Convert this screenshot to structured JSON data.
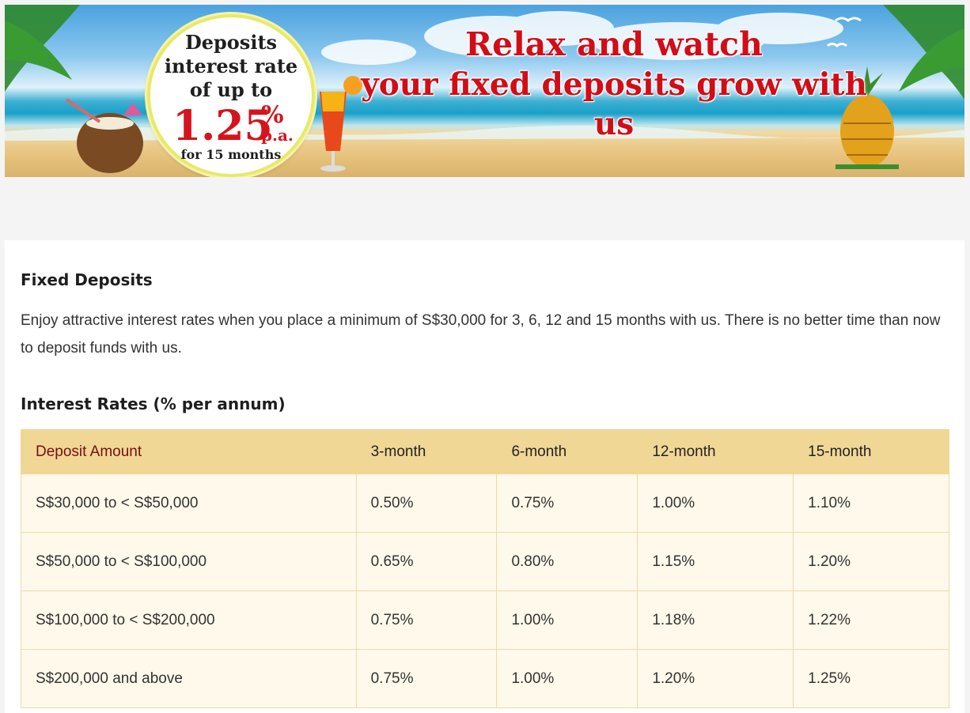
{
  "banner": {
    "badge": {
      "line1": "Deposits",
      "line2": "interest rate",
      "line3": "of up to",
      "rate": "1.25",
      "percent": "%",
      "pa": "p.a.",
      "term": "for 15 months"
    },
    "headline_line1": "Relax and watch",
    "headline_line2": "your fixed deposits grow with us",
    "accent_color": "#d10d17"
  },
  "content": {
    "title": "Fixed Deposits",
    "description": "Enjoy attractive interest rates when you place a minimum of S$30,000 for 3, 6, 12 and 15 months with us. There is no better time than now to deposit funds with us.",
    "rates_title": "Interest Rates (% per annum)"
  },
  "rates_table": {
    "headers": [
      "Deposit Amount",
      "3-month",
      "6-month",
      "12-month",
      "15-month"
    ],
    "rows": [
      [
        "S$30,000 to < S$50,000",
        "0.50%",
        "0.75%",
        "1.00%",
        "1.10%"
      ],
      [
        "S$50,000 to < S$100,000",
        "0.65%",
        "0.80%",
        "1.15%",
        "1.20%"
      ],
      [
        "S$100,000 to < S$200,000",
        "0.75%",
        "1.00%",
        "1.18%",
        "1.22%"
      ],
      [
        "S$200,000 and above",
        "0.75%",
        "1.00%",
        "1.20%",
        "1.25%"
      ]
    ],
    "header_bg": "#f0d796",
    "row_bg": "#fef9ea"
  }
}
